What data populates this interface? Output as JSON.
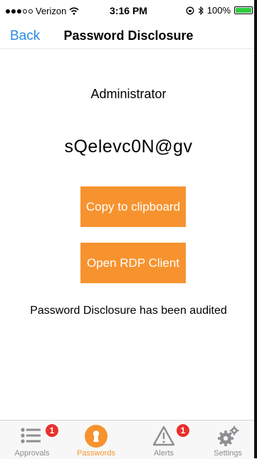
{
  "status_bar": {
    "carrier": "Verizon",
    "time": "3:16 PM",
    "battery": "100%"
  },
  "nav": {
    "back_label": "Back",
    "title": "Password Disclosure"
  },
  "content": {
    "account_name": "Administrator",
    "password": "sQelevc0N@gv",
    "copy_button": "Copy to clipboard",
    "rdp_button": "Open RDP Client",
    "audit_message": "Password Disclosure has been audited"
  },
  "tabs": [
    {
      "label": "Approvals",
      "icon": "list-icon",
      "badge": "1",
      "active": false
    },
    {
      "label": "Passwords",
      "icon": "keyhole-icon",
      "badge": "",
      "active": true
    },
    {
      "label": "Alerts",
      "icon": "warning-icon",
      "badge": "1",
      "active": false
    },
    {
      "label": "Settings",
      "icon": "gears-icon",
      "badge": "",
      "active": false
    }
  ],
  "colors": {
    "accent": "#f7932f",
    "link": "#2a8be3",
    "badge": "#e8302f",
    "inactive": "#8e8e93"
  }
}
